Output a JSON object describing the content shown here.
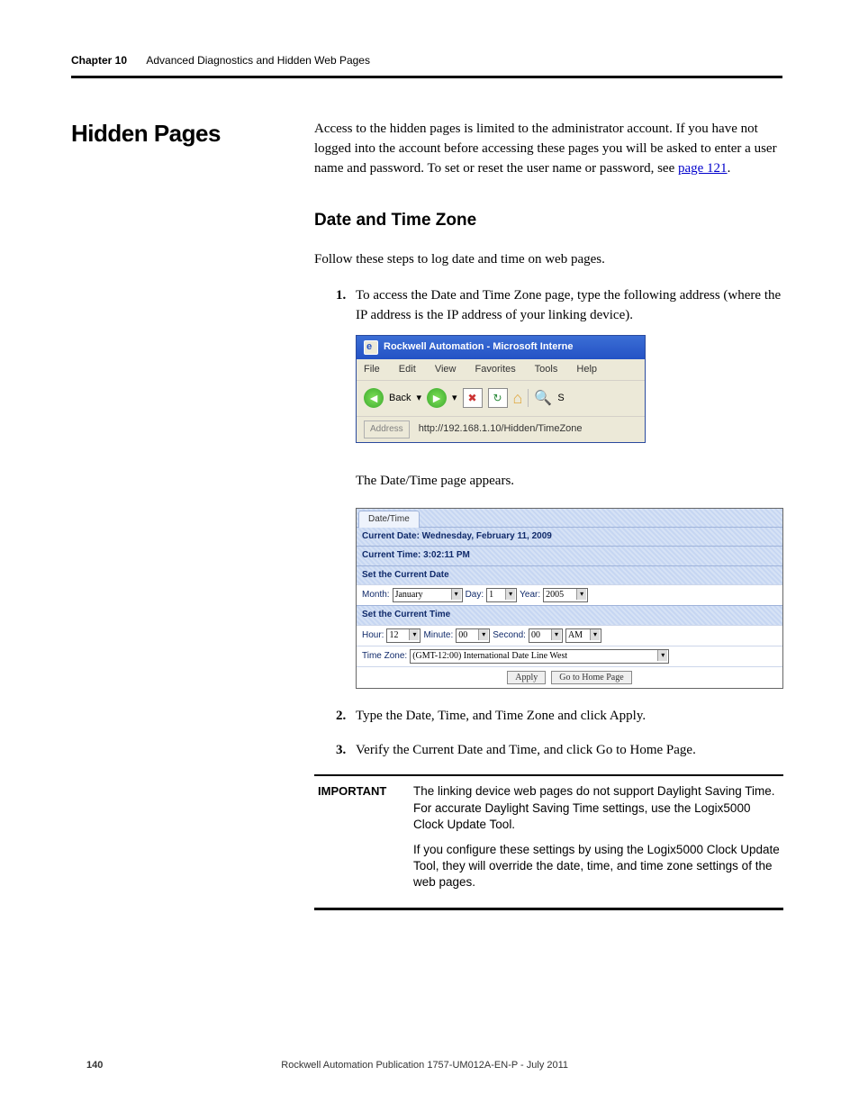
{
  "header": {
    "chapter": "Chapter 10",
    "title": "Advanced Diagnostics and Hidden Web Pages"
  },
  "section_title": "Hidden Pages",
  "intro_text": "Access to the hidden pages is limited to the administrator account. If you have not logged into the account before accessing these pages you will be asked to enter a user name and password. To set or reset the user name or password, see ",
  "intro_link": "page 121",
  "intro_suffix": ".",
  "subsection_title": "Date and Time Zone",
  "lead": "Follow these steps to log date and time on web pages.",
  "steps": {
    "s1": "To access the Date and Time Zone page, type the following address (where the IP address is the IP address of your linking device).",
    "caption_after_browser": "The Date/Time page appears.",
    "s2": "Type the Date, Time, and Time Zone and click Apply.",
    "s3": "Verify the Current Date and Time, and click Go to Home Page."
  },
  "browser": {
    "title": "Rockwell Automation - Microsoft Interne",
    "menu": {
      "file": "File",
      "edit": "Edit",
      "view": "View",
      "favorites": "Favorites",
      "tools": "Tools",
      "help": "Help"
    },
    "toolbar": {
      "back": "Back",
      "arrow": "▾",
      "search_letter": "S"
    },
    "address_label": "Address",
    "url": "http://192.168.1.10/Hidden/TimeZone"
  },
  "dtpanel": {
    "tab": "Date/Time",
    "current_date_label": "Current Date: Wednesday, February 11, 2009",
    "current_time_label": "Current Time: 3:02:11 PM",
    "set_date_header": "Set the Current Date",
    "month_label": "Month:",
    "month_value": "January",
    "day_label": "Day:",
    "day_value": "1",
    "year_label": "Year:",
    "year_value": "2005",
    "set_time_header": "Set the Current Time",
    "hour_label": "Hour:",
    "hour_value": "12",
    "minute_label": "Minute:",
    "minute_value": "00",
    "second_label": "Second:",
    "second_value": "00",
    "ampm_value": "AM",
    "tz_label": "Time Zone:",
    "tz_value": "(GMT-12:00) International Date Line West",
    "apply": "Apply",
    "home": "Go to Home Page"
  },
  "important": {
    "tag": "IMPORTANT",
    "p1": "The linking device web pages do not support Daylight Saving Time. For accurate Daylight Saving Time settings, use the Logix5000 Clock Update Tool.",
    "p2": "If you configure these settings by using the Logix5000 Clock Update Tool, they will override the date, time, and time zone settings of the web pages."
  },
  "footer": {
    "page": "140",
    "pub": "Rockwell Automation Publication 1757-UM012A-EN-P - July 2011"
  }
}
